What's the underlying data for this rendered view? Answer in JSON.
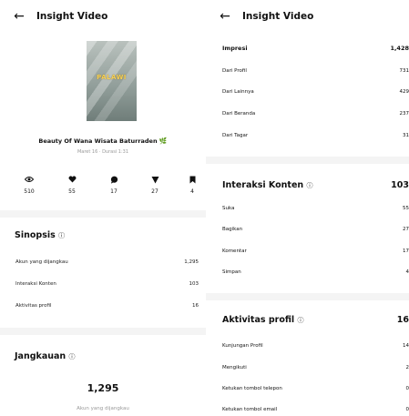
{
  "left": {
    "header": {
      "title": "Insight Video"
    },
    "thumbnail_text": "PALAWI",
    "video_title": "Beauty Of Wana Wisata Baturraden",
    "video_meta": "Maret 16 · Durasi 1:31",
    "stats": [
      {
        "icon": "eye-icon",
        "value": "510"
      },
      {
        "icon": "heart-icon",
        "value": "55"
      },
      {
        "icon": "comment-icon",
        "value": "17"
      },
      {
        "icon": "share-icon",
        "value": "27"
      },
      {
        "icon": "bookmark-icon",
        "value": "4"
      }
    ],
    "sinopsis": {
      "title": "Sinopsis",
      "rows": [
        {
          "label": "Akun yang dijangkau",
          "value": "1,295"
        },
        {
          "label": "Interaksi Konten",
          "value": "103"
        },
        {
          "label": "Aktivitas profil",
          "value": "16"
        }
      ]
    },
    "jangkauan": {
      "title": "Jangkauan",
      "value": "1,295",
      "caption": "Akun yang dijangkau"
    }
  },
  "right": {
    "header": {
      "title": "Insight Video"
    },
    "impresi": {
      "label": "Impresi",
      "value": "1,428"
    },
    "impresi_rows": [
      {
        "label": "Dari Profil",
        "value": "731"
      },
      {
        "label": "Dari Lainnya",
        "value": "429"
      },
      {
        "label": "Dari Beranda",
        "value": "237"
      },
      {
        "label": "Dari Tagar",
        "value": "31"
      }
    ],
    "interaksi": {
      "title": "Interaksi Konten",
      "value": "103"
    },
    "interaksi_rows": [
      {
        "label": "Suka",
        "value": "55"
      },
      {
        "label": "Bagikan",
        "value": "27"
      },
      {
        "label": "Komentar",
        "value": "17"
      },
      {
        "label": "Simpan",
        "value": "4"
      }
    ],
    "aktivitas": {
      "title": "Aktivitas profil",
      "value": "16"
    },
    "aktivitas_rows": [
      {
        "label": "Kunjungan Profil",
        "value": "14"
      },
      {
        "label": "Mengikuti",
        "value": "2"
      },
      {
        "label": "Ketukan tombol telepon",
        "value": "0"
      },
      {
        "label": "Ketukan tombol email",
        "value": "0"
      }
    ]
  },
  "colors": {
    "accent_leaf": "#4caf50",
    "divider": "#f4f4f4",
    "muted": "#999999"
  }
}
